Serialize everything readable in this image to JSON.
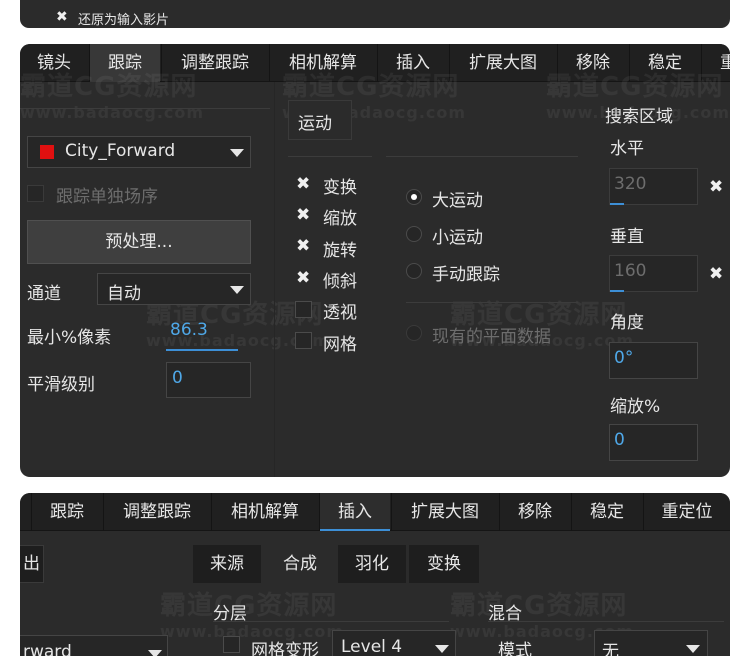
{
  "top_panel": {
    "reset_label": "还原为输入影片"
  },
  "tabs_main": [
    "镜头",
    "跟踪",
    "调整跟踪",
    "相机解算",
    "插入",
    "扩展大图",
    "移除",
    "稳定",
    "重"
  ],
  "tabs_bottom": [
    "跟踪",
    "调整跟踪",
    "相机解算",
    "插入",
    "扩展大图",
    "移除",
    "稳定",
    "重定位"
  ],
  "watermark": {
    "title": "霸道CG资源网",
    "url": "www.badaocg.com"
  },
  "tracking": {
    "layer_select": "City_Forward",
    "layer_color": "#e01010",
    "track_single_frame": "跟踪单独场序",
    "preprocess": "预处理...",
    "channel_label": "通道",
    "channel_value": "自动",
    "min_pixels_label": "最小%像素",
    "min_pixels_value": "86.3",
    "smoothing_label": "平滑级别",
    "smoothing_value": "0"
  },
  "motion": {
    "header": "运动",
    "types": [
      {
        "label": "变换",
        "checked": true
      },
      {
        "label": "缩放",
        "checked": true
      },
      {
        "label": "旋转",
        "checked": true
      },
      {
        "label": "倾斜",
        "checked": true
      },
      {
        "label": "透视",
        "checked": false
      },
      {
        "label": "网格",
        "checked": false
      }
    ],
    "modes": [
      {
        "label": "大运动",
        "selected": true
      },
      {
        "label": "小运动",
        "selected": false
      },
      {
        "label": "手动跟踪",
        "selected": false
      }
    ],
    "existing_plane": "现有的平面数据"
  },
  "search_area": {
    "header": "搜索区域",
    "horizontal_label": "水平",
    "horizontal_value": "320",
    "vertical_label": "垂直",
    "vertical_value": "160",
    "angle_label": "角度",
    "angle_value": "0°",
    "zoom_label": "缩放%",
    "zoom_value": "0"
  },
  "insert": {
    "subtabs": [
      "来源",
      "合成",
      "羽化",
      "变换"
    ],
    "left_button_fragment": "出",
    "layering_label": "分层",
    "blend_label": "混合",
    "mesh_warp_label": "网格变形",
    "mesh_level": "Level 4",
    "mode_label": "模式",
    "mode_value": "无",
    "layer_fragment": "rward"
  }
}
